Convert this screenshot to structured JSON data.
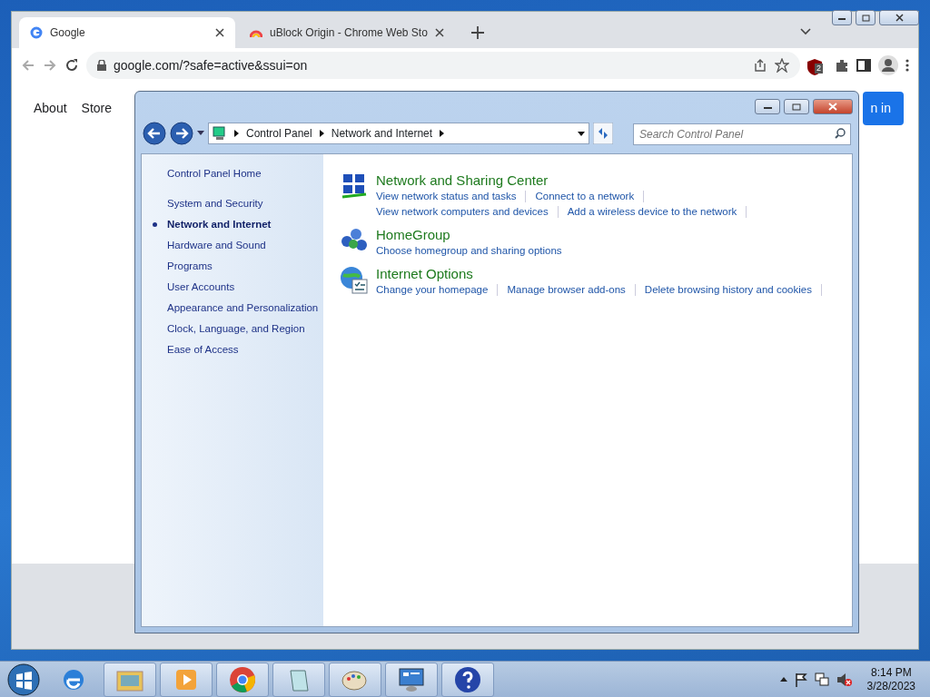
{
  "browser": {
    "tabs": [
      {
        "title": "Google",
        "selected": true
      },
      {
        "title": "uBlock Origin - Chrome Web Sto",
        "selected": false
      }
    ],
    "address": "google.com/?safe=active&ssui=on",
    "extension_badge": "2",
    "page": {
      "links": [
        "About",
        "Store"
      ],
      "sign_in_button": "n in"
    }
  },
  "control_panel": {
    "breadcrumb": [
      "Control Panel",
      "Network and Internet"
    ],
    "search": {
      "placeholder": "Search Control Panel"
    },
    "sidebar": {
      "home": "Control Panel Home",
      "items": [
        {
          "label": "System and Security",
          "selected": false
        },
        {
          "label": "Network and Internet",
          "selected": true
        },
        {
          "label": "Hardware and Sound",
          "selected": false
        },
        {
          "label": "Programs",
          "selected": false
        },
        {
          "label": "User Accounts",
          "selected": false
        },
        {
          "label": "Appearance and Personalization",
          "selected": false
        },
        {
          "label": "Clock, Language, and Region",
          "selected": false
        },
        {
          "label": "Ease of Access",
          "selected": false
        }
      ]
    },
    "categories": [
      {
        "kind": "network",
        "title": "Network and Sharing Center",
        "link_rows": [
          [
            "View network status and tasks",
            "Connect to a network"
          ],
          [
            "View network computers and devices",
            "Add a wireless device to the network"
          ]
        ]
      },
      {
        "kind": "homegroup",
        "title": "HomeGroup",
        "link_rows": [
          [
            "Choose homegroup and sharing options"
          ]
        ]
      },
      {
        "kind": "internet",
        "title": "Internet Options",
        "link_rows": [
          [
            "Change your homepage",
            "Manage browser add-ons",
            "Delete browsing history and cookies"
          ]
        ]
      }
    ]
  },
  "taskbar": {
    "time": "8:14 PM",
    "date": "3/28/2023"
  }
}
